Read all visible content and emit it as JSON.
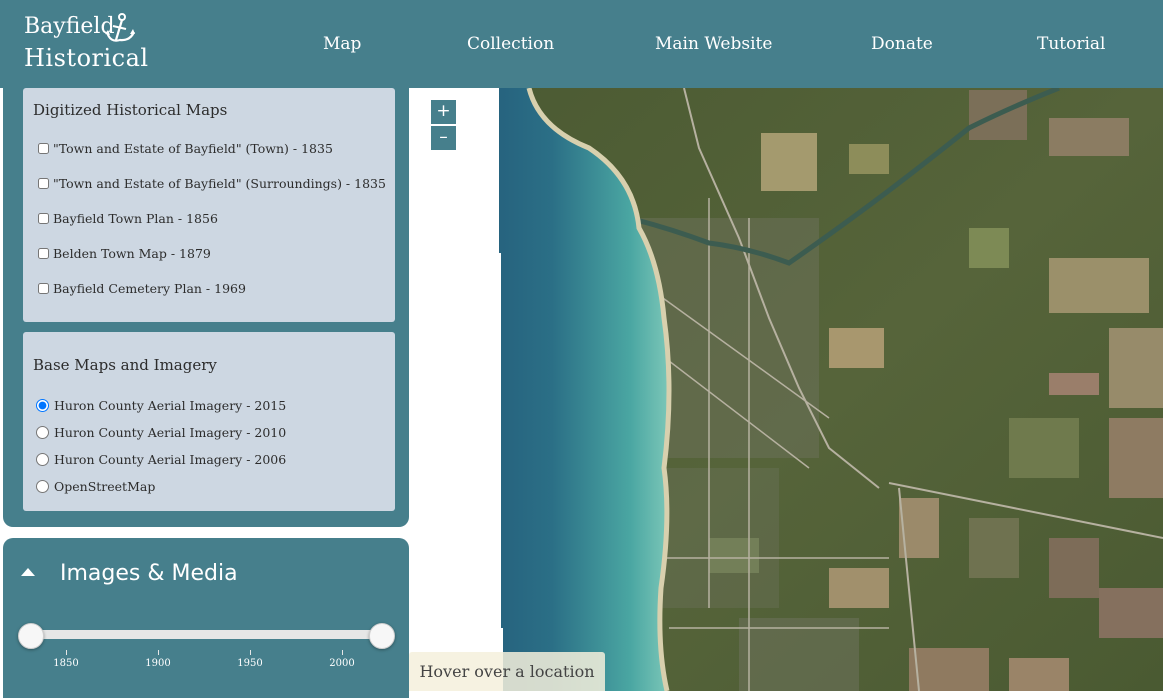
{
  "logo": {
    "line1": "Bayfield",
    "line2": "Historical"
  },
  "nav": {
    "map": "Map",
    "collection": "Collection",
    "main_website": "Main Website",
    "donate": "Donate",
    "tutorial": "Tutorial"
  },
  "historical_maps": {
    "title": "Digitized Historical Maps",
    "items": [
      {
        "label": "\"Town and Estate of Bayfield\" (Town) - 1835",
        "checked": false
      },
      {
        "label": "\"Town and Estate of Bayfield\" (Surroundings) - 1835",
        "checked": false
      },
      {
        "label": "Bayfield Town Plan - 1856",
        "checked": false
      },
      {
        "label": "Belden Town Map - 1879",
        "checked": false
      },
      {
        "label": "Bayfield Cemetery Plan - 1969",
        "checked": false
      }
    ]
  },
  "base_maps": {
    "title": "Base Maps and Imagery",
    "items": [
      {
        "label": "Huron County Aerial Imagery - 2015",
        "selected": true
      },
      {
        "label": "Huron County Aerial Imagery - 2010",
        "selected": false
      },
      {
        "label": "Huron County Aerial Imagery - 2006",
        "selected": false
      },
      {
        "label": "OpenStreetMap",
        "selected": false
      }
    ]
  },
  "media": {
    "title": "Images & Media",
    "ticks": [
      "1850",
      "1900",
      "1950",
      "2000"
    ]
  },
  "map": {
    "zoom_in": "+",
    "zoom_out": "–",
    "hover_text": "Hover over a location"
  },
  "colors": {
    "brand": "#467f8c",
    "card": "#cdd7e2"
  }
}
